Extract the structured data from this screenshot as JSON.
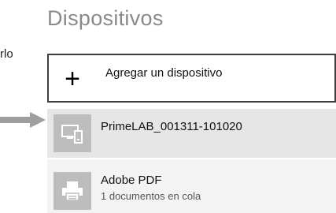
{
  "cut_text": "rlo",
  "heading": "Dispositivos",
  "add_device": {
    "label": "Agregar un dispositivo",
    "icon": "plus-icon"
  },
  "devices": [
    {
      "name": "PrimeLAB_001311-101020",
      "icon": "devices-icon"
    },
    {
      "name": "Adobe PDF",
      "status": "1 documentos en cola",
      "icon": "printer-icon"
    }
  ],
  "colors": {
    "heading": "#8a8a8a",
    "selected_bg": "#e6e6e6",
    "tile_bg": "#bdbdbd",
    "arrow": "#9e9e9e"
  }
}
